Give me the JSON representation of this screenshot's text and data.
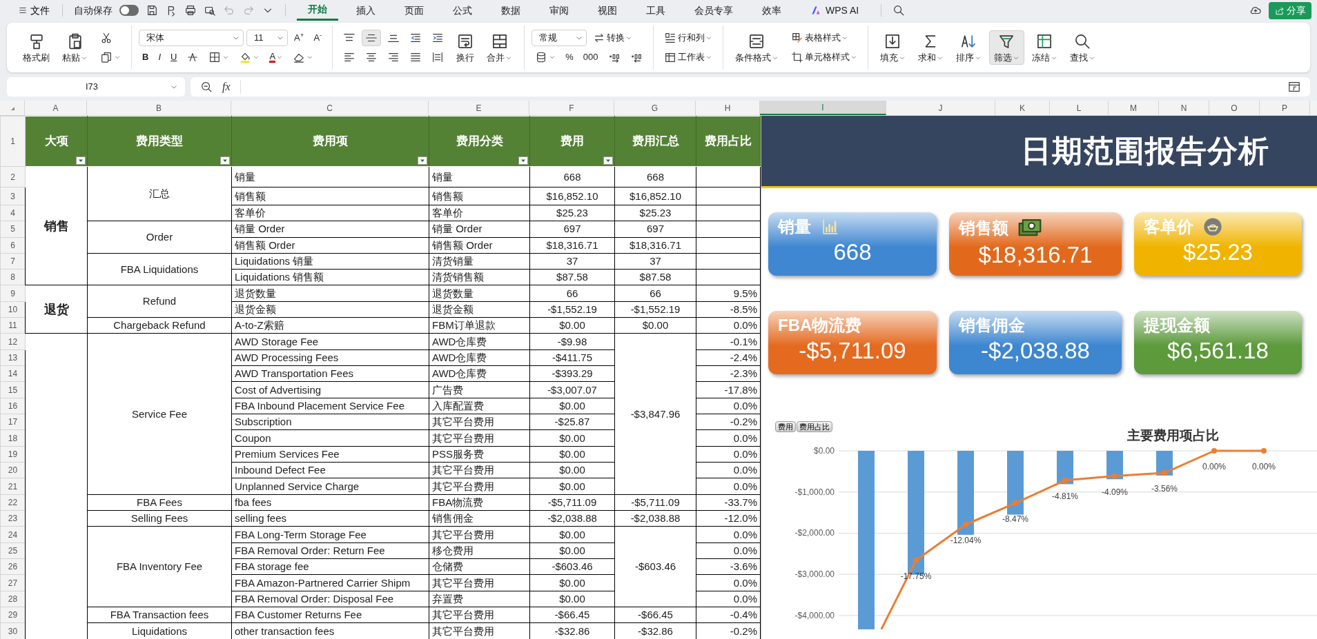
{
  "title_bar": {
    "file_menu": "文件",
    "autosave": {
      "label": "自动保存",
      "on": false
    },
    "quick_access": [
      {
        "disabled": false
      },
      {
        "disabled": false
      },
      {
        "disabled": false
      },
      {
        "disabled": false
      },
      {
        "disabled": true
      },
      {
        "disabled": true
      },
      {
        "disabled": false
      }
    ],
    "tabs": [
      {
        "label": "开始",
        "selected": true
      },
      {
        "label": "插入",
        "selected": false
      },
      {
        "label": "页面",
        "selected": false
      },
      {
        "label": "公式",
        "selected": false
      },
      {
        "label": "数据",
        "selected": false
      },
      {
        "label": "审阅",
        "selected": false
      },
      {
        "label": "视图",
        "selected": false
      },
      {
        "label": "工具",
        "selected": false
      },
      {
        "label": "会员专享",
        "selected": false
      },
      {
        "label": "效率",
        "selected": false
      },
      {
        "label": "WPS AI",
        "selected": false
      }
    ],
    "share": "分享"
  },
  "ribbon": {
    "groups": [
      {
        "sections": [
          {
            "kind": "large",
            "items": [
              {
                "label": "格式刷"
              },
              {
                "label": "粘贴",
                "dropdown": true
              }
            ]
          },
          {
            "kind": "stack",
            "lines": [
              {
                "items": [
                  {
                    "kind": "button"
                  }
                ]
              },
              {
                "items": [
                  {
                    "kind": "button",
                    "dropdown": true
                  }
                ]
              }
            ]
          }
        ]
      },
      {
        "sections": [
          {
            "kind": "stack",
            "lines": [
              {
                "items": [
                  {
                    "kind": "select",
                    "value": "宋体"
                  },
                  {
                    "kind": "select",
                    "value": "11"
                  },
                  {
                    "kind": "button",
                    "label": "A$^{+}$"
                  },
                  {
                    "kind": "button",
                    "label": "A$^{-}$"
                  }
                ]
              },
              {
                "items": [
                  {
                    "kind": "button",
                    "label": "B"
                  },
                  {
                    "kind": "button",
                    "label": "I"
                  },
                  {
                    "kind": "button",
                    "label": "U"
                  },
                  {
                    "kind": "button"
                  },
                  {
                    "kind": "button",
                    "dropdown": true
                  },
                  {
                    "kind": "button",
                    "dropdown": true
                  },
                  {
                    "kind": "button",
                    "label": "A",
                    "dropdown": true
                  },
                  {
                    "kind": "button",
                    "dropdown": true
                  }
                ]
              }
            ]
          }
        ]
      },
      {
        "sections": [
          {
            "kind": "stack",
            "lines": [
              {
                "items": [
                  {
                    "kind": "button",
                    "selected": false
                  },
                  {
                    "kind": "button",
                    "selected": true
                  },
                  {
                    "kind": "button",
                    "selected": false
                  },
                  {
                    "kind": "button"
                  },
                  {
                    "kind": "button"
                  }
                ]
              },
              {
                "items": [
                  {
                    "kind": "button"
                  },
                  {
                    "kind": "button"
                  },
                  {
                    "kind": "button"
                  },
                  {
                    "kind": "button"
                  },
                  {
                    "kind": "button"
                  }
                ]
              }
            ]
          },
          {
            "kind": "large",
            "items": [
              {
                "label": "换行"
              },
              {
                "label": "合并",
                "dropdown": true
              }
            ]
          }
        ]
      },
      {
        "sections": [
          {
            "kind": "stack",
            "lines": [
              {
                "items": [
                  {
                    "kind": "select",
                    "value": "常规"
                  },
                  {
                    "kind": "button",
                    "label": "转换",
                    "dropdown": true
                  }
                ]
              },
              {
                "items": [
                  {
                    "kind": "button",
                    "dropdown": true
                  },
                  {
                    "kind": "button",
                    "label": "%"
                  },
                  {
                    "kind": "button",
                    "label": "000"
                  },
                  {
                    "kind": "button"
                  },
                  {
                    "kind": "button"
                  }
                ]
              }
            ]
          }
        ]
      },
      {
        "sections": [
          {
            "kind": "stack",
            "lines": [
              {
                "items": [
                  {
                    "kind": "button",
                    "label": "行和列",
                    "dropdown": true
                  }
                ]
              },
              {
                "items": [
                  {
                    "kind": "button",
                    "label": "工作表",
                    "dropdown": true
                  }
                ]
              }
            ]
          }
        ]
      },
      {
        "sections": [
          {
            "kind": "large",
            "items": [
              {
                "label": "条件格式",
                "dropdown": true
              }
            ]
          },
          {
            "kind": "stack",
            "lines": [
              {
                "items": [
                  {
                    "kind": "button",
                    "label": "表格样式",
                    "dropdown": true
                  }
                ]
              },
              {
                "items": [
                  {
                    "kind": "button",
                    "label": "单元格样式",
                    "dropdown": true
                  }
                ]
              }
            ]
          }
        ]
      },
      {
        "sections": [
          {
            "kind": "large",
            "items": [
              {
                "label": "填充",
                "dropdown": true,
                "selected": false
              },
              {
                "label": "求和",
                "dropdown": true,
                "selected": false
              },
              {
                "label": "排序",
                "dropdown": true,
                "selected": false
              },
              {
                "label": "筛选",
                "dropdown": true,
                "selected": true
              },
              {
                "label": "冻结",
                "dropdown": true,
                "selected": false
              },
              {
                "label": "查找",
                "dropdown": true,
                "selected": false
              }
            ]
          }
        ]
      }
    ]
  },
  "formula_bar": {
    "name_box": "I73",
    "fx": "fx"
  },
  "sheet": {
    "columns": [
      {
        "label": "A",
        "selected": false
      },
      {
        "label": "B",
        "selected": false
      },
      {
        "label": "C",
        "selected": false
      },
      {
        "label": "E",
        "selected": false
      },
      {
        "label": "F",
        "selected": false
      },
      {
        "label": "G",
        "selected": false
      },
      {
        "label": "H",
        "selected": false
      },
      {
        "label": "I",
        "selected": true
      },
      {
        "label": "J",
        "selected": false
      },
      {
        "label": "K",
        "selected": false
      },
      {
        "label": "L",
        "selected": false
      },
      {
        "label": "M",
        "selected": false
      },
      {
        "label": "N",
        "selected": false
      },
      {
        "label": "O",
        "selected": false
      },
      {
        "label": "P",
        "selected": false
      }
    ],
    "row_numbers": [
      "1",
      "2",
      "3",
      "4",
      "5",
      "6",
      "7",
      "8",
      "9",
      "10",
      "11",
      "12",
      "13",
      "14",
      "15",
      "16",
      "17",
      "18",
      "19",
      "20",
      "21",
      "22",
      "23",
      "24",
      "25",
      "26",
      "27",
      "28",
      "29",
      "30"
    ],
    "header": [
      {
        "label": "大项",
        "filter": true
      },
      {
        "label": "费用类型",
        "filter": true
      },
      {
        "label": "费用项",
        "filter": true
      },
      {
        "label": "费用分类",
        "filter": true
      },
      {
        "label": "费用",
        "filter": true
      },
      {
        "label": "费用汇总",
        "filter": false
      },
      {
        "label": "费用占比",
        "filter": false
      }
    ],
    "groups": [
      {
        "name": "销售",
        "types": [
          {
            "name": "汇总",
            "items": [
              {
                "item": "销量",
                "class": "销量",
                "fee": "668",
                "total": "668"
              },
              {
                "item": "销售额",
                "class": "销售额",
                "fee": "$16,852.10",
                "total": "$16,852.10"
              },
              {
                "item": "客单价",
                "class": "客单价",
                "fee": "$25.23",
                "total": "$25.23"
              }
            ]
          },
          {
            "name": "Order",
            "items": [
              {
                "item": "销量 Order",
                "class": "销量 Order",
                "fee": "697",
                "total": "697"
              },
              {
                "item": "销售额 Order",
                "class": "销售额 Order",
                "fee": "$18,316.71",
                "total": "$18,316.71"
              }
            ]
          },
          {
            "name": "FBA Liquidations",
            "items": [
              {
                "item": "Liquidations 销量",
                "class": "清货销量",
                "fee": "37",
                "total": "37"
              },
              {
                "item": "Liquidations 销售额",
                "class": "清货销售额",
                "fee": "$87.58",
                "total": "$87.58"
              }
            ]
          }
        ]
      },
      {
        "name": "退货",
        "types": [
          {
            "name": "Refund",
            "items": [
              {
                "item": "退货数量",
                "class": "退货数量",
                "fee": "66",
                "total": "66",
                "share": "9.5%"
              },
              {
                "item": "退货金额",
                "class": "退货金额",
                "fee": "-$1,552.19",
                "total": "-$1,552.19",
                "share": "-8.5%"
              }
            ]
          },
          {
            "name": "Chargeback Refund",
            "items": [
              {
                "item": "A-to-Z索赔",
                "class": "FBM订单退款",
                "fee": "$0.00",
                "total": "$0.00",
                "share": "0.0%"
              }
            ]
          }
        ]
      },
      {
        "types": [
          {
            "name": "Service Fee",
            "total": "-$3,847.96",
            "items": [
              {
                "item": "AWD Storage Fee",
                "class": "AWD仓库费",
                "fee": "-$9.98",
                "share": "-0.1%"
              },
              {
                "item": "AWD Processing Fees",
                "class": "AWD仓库费",
                "fee": "-$411.75",
                "share": "-2.4%"
              },
              {
                "item": "AWD Transportation Fees",
                "class": "AWD仓库费",
                "fee": "-$393.29",
                "share": "-2.3%"
              },
              {
                "item": "Cost of Advertising",
                "class": "广告费",
                "fee": "-$3,007.07",
                "share": "-17.8%"
              },
              {
                "item": "FBA Inbound Placement Service Fee",
                "class": "入库配置费",
                "fee": "$0.00",
                "share": "0.0%"
              },
              {
                "item": "Subscription",
                "class": "其它平台费用",
                "fee": "-$25.87",
                "share": "-0.2%"
              },
              {
                "item": "Coupon",
                "class": "其它平台费用",
                "fee": "$0.00",
                "share": "0.0%"
              },
              {
                "item": "Premium Services Fee",
                "class": "PSS服务费",
                "fee": "$0.00",
                "share": "0.0%"
              },
              {
                "item": "Inbound Defect Fee",
                "class": "其它平台费用",
                "fee": "$0.00",
                "share": "0.0%"
              },
              {
                "item": "Unplanned Service Charge",
                "class": "其它平台费用",
                "fee": "$0.00",
                "share": "0.0%"
              }
            ]
          },
          {
            "name": "FBA Fees",
            "items": [
              {
                "item": "fba fees",
                "class": "FBA物流费",
                "fee": "-$5,711.09",
                "total": "-$5,711.09",
                "share": "-33.7%"
              }
            ]
          },
          {
            "name": "Selling Fees",
            "items": [
              {
                "item": "selling fees",
                "class": "销售佣金",
                "fee": "-$2,038.88",
                "total": "-$2,038.88",
                "share": "-12.0%"
              }
            ]
          },
          {
            "name": "FBA Inventory Fee",
            "total": "-$603.46",
            "items": [
              {
                "item": "FBA Long-Term Storage Fee",
                "class": "其它平台费用",
                "fee": "$0.00",
                "share": "0.0%"
              },
              {
                "item": "FBA Removal Order: Return Fee",
                "class": "移仓费用",
                "fee": "$0.00",
                "share": "0.0%"
              },
              {
                "item": "FBA storage fee",
                "class": "仓储费",
                "fee": "-$603.46",
                "share": "-3.6%"
              },
              {
                "item": "FBA Amazon-Partnered Carrier Shipm",
                "class": "其它平台费用",
                "fee": "$0.00",
                "share": "0.0%"
              },
              {
                "item": "FBA Removal Order: Disposal Fee",
                "class": "弃置费",
                "fee": "$0.00",
                "share": "0.0%"
              }
            ]
          },
          {
            "name": "FBA Transaction fees",
            "items": [
              {
                "item": "FBA Customer Returns Fee",
                "class": "其它平台费用",
                "fee": "-$66.45",
                "total": "-$66.45",
                "share": "-0.4%"
              }
            ]
          },
          {
            "name": "Liquidations",
            "items": [
              {
                "item": "other transaction fees",
                "class": "其它平台费用",
                "fee": "-$32.86",
                "total": "-$32.86",
                "share": "-0.2%"
              }
            ]
          }
        ]
      }
    ]
  },
  "dashboard": {
    "title": "日期范围报告分析",
    "cards": [
      {
        "label": "销量",
        "value": "668",
        "color": "#3f87d1"
      },
      {
        "label": "销售额",
        "value": "$18,316.71",
        "color": "#e2691c"
      },
      {
        "label": "客单价",
        "value": "$25.23",
        "color": "#f0b400"
      },
      {
        "label": "FBA物流费",
        "value": "-$5,711.09",
        "color": "#e46a1f"
      },
      {
        "label": "销售佣金",
        "value": "-$2,038.88",
        "color": "#3d86d0"
      },
      {
        "label": "提现金额",
        "value": "$6,561.18",
        "color": "#5c9a3c"
      }
    ],
    "chart": {
      "chart_data": {
        "type": "bar",
        "title": "主要费用项占比",
        "grid": true,
        "series": [
          {
            "name": "费用",
            "color": "#5b9bd5",
            "values": [
              -4335,
              -3010,
              -2040,
              -1550,
              -810,
              -690,
              -600,
              0,
              0
            ]
          },
          {
            "name": "费用占比",
            "color": "#ed7d31",
            "values": [
              -0.339,
              -0.178,
              -0.12,
              -0.085,
              -0.048,
              -0.041,
              -0.036,
              0,
              0
            ]
          }
        ],
        "ylim": [
          -4335,
          0
        ],
        "yticks": [
          {
            "value": 0,
            "label": "$0.00"
          },
          {
            "value": -1000,
            "label": "-$1,000.00"
          },
          {
            "value": -2000,
            "label": "-$2,000.00"
          },
          {
            "value": -3000,
            "label": "-$3,000.00"
          },
          {
            "value": -4000,
            "label": "-$4,000.00"
          }
        ],
        "value_labels": [
          null,
          "-17.75%",
          "-12.04%",
          "-8.47%",
          "-4.81%",
          "-4.09%",
          "-3.56%",
          "0.00%",
          "0.00%"
        ]
      }
    }
  }
}
